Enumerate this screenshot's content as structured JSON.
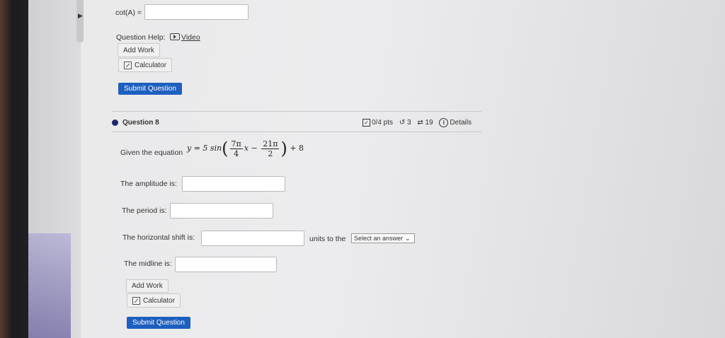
{
  "previous_question": {
    "cot_label": "cot(A) =",
    "question_help_label": "Question Help:",
    "video_label": "Video",
    "add_work_label": "Add Work",
    "calculator_label": "Calculator",
    "submit_label": "Submit Question"
  },
  "question": {
    "title": "Question 8",
    "points": "0/4 pts",
    "retries": "3",
    "attempts": "19",
    "details_label": "Details",
    "prompt_prefix": "Given the equation",
    "equation": {
      "lhs": "y = 5 sin",
      "frac1_num": "7π",
      "frac1_den": "4",
      "var": "x",
      "minus": "−",
      "frac2_num": "21π",
      "frac2_den": "2",
      "tail": "+ 8"
    },
    "amplitude_label": "The amplitude is:",
    "period_label": "The period is:",
    "shift_label": "The horizontal shift is:",
    "shift_units": "units to the",
    "shift_select": "Select an answer",
    "midline_label": "The midline is:",
    "add_work_label": "Add Work",
    "calculator_label": "Calculator",
    "submit_label": "Submit Question"
  },
  "colors": {
    "accent": "#1e5fbf",
    "dot": "#1a2a6e"
  }
}
